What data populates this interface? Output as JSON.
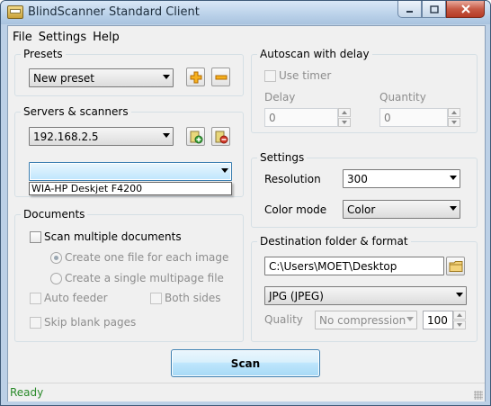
{
  "window": {
    "title": "BlindScanner Standard Client"
  },
  "menu": {
    "items": [
      "File",
      "Settings",
      "Help"
    ]
  },
  "presets": {
    "title": "Presets",
    "selected": "New preset"
  },
  "servers": {
    "title": "Servers & scanners",
    "server": "192.168.2.5",
    "scanner": "",
    "list_items": [
      "WIA-HP Deskjet F4200"
    ]
  },
  "documents": {
    "title": "Documents",
    "scan_multiple": "Scan multiple documents",
    "one_file": "Create one file for each image",
    "multipage": "Create a single multipage file",
    "auto_feeder": "Auto feeder",
    "both_sides": "Both sides",
    "skip_blank": "Skip blank pages"
  },
  "autoscan": {
    "title": "Autoscan with delay",
    "use_timer": "Use timer",
    "delay_label": "Delay",
    "delay_value": "0",
    "quantity_label": "Quantity",
    "quantity_value": "0"
  },
  "settings": {
    "title": "Settings",
    "resolution_label": "Resolution",
    "resolution_value": "300",
    "color_label": "Color mode",
    "color_value": "Color"
  },
  "destination": {
    "title": "Destination folder & format",
    "folder": "C:\\Users\\MOET\\Desktop",
    "format": "JPG (JPEG)",
    "quality_label": "Quality",
    "compression": "No compression",
    "quality_value": "100"
  },
  "scan_button": "Scan",
  "status": "Ready",
  "colors": {
    "status_text": "#2a8a2a",
    "scan_button_border": "#3c7fb1"
  }
}
